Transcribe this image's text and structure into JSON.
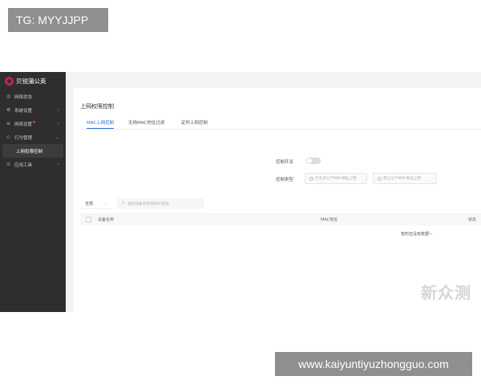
{
  "overlay": {
    "tg_badge": "TG: MYYJJPP",
    "site_banner": "www.kaiyuntiyuzhongguo.com",
    "corner_logo": "新众测"
  },
  "sidebar": {
    "brand": "贝锐蒲公英",
    "items": [
      {
        "label": "网络状态",
        "icon": "globe-icon"
      },
      {
        "label": "系统设置",
        "icon": "gear-icon"
      },
      {
        "label": "网络设置",
        "icon": "list-icon"
      },
      {
        "label": "行为管理",
        "icon": "shield-icon"
      },
      {
        "label": "上网权限控制"
      },
      {
        "label": "应用工具",
        "icon": "tools-icon"
      }
    ]
  },
  "panel": {
    "title": "上网权限控制",
    "tabs": [
      "MAC上网控制",
      "无线MAC地址过滤",
      "定时上网控制"
    ],
    "control_switch_label": "控制开关",
    "control_type_label": "控制类型",
    "option_allow": "只允许以下MAC地址上网",
    "option_deny": "禁止以下MAC地址上网",
    "filter_value": "全部",
    "search_placeholder": "搜索设备名称或MAC地址",
    "table_headers": [
      "设备名称",
      "MAC地址",
      "状态"
    ],
    "empty_message": "暂时还没有数据~"
  },
  "colors": {
    "sidebar_bg": "#2e2e30",
    "accent": "#2b73d6",
    "brand": "#c2224f"
  }
}
